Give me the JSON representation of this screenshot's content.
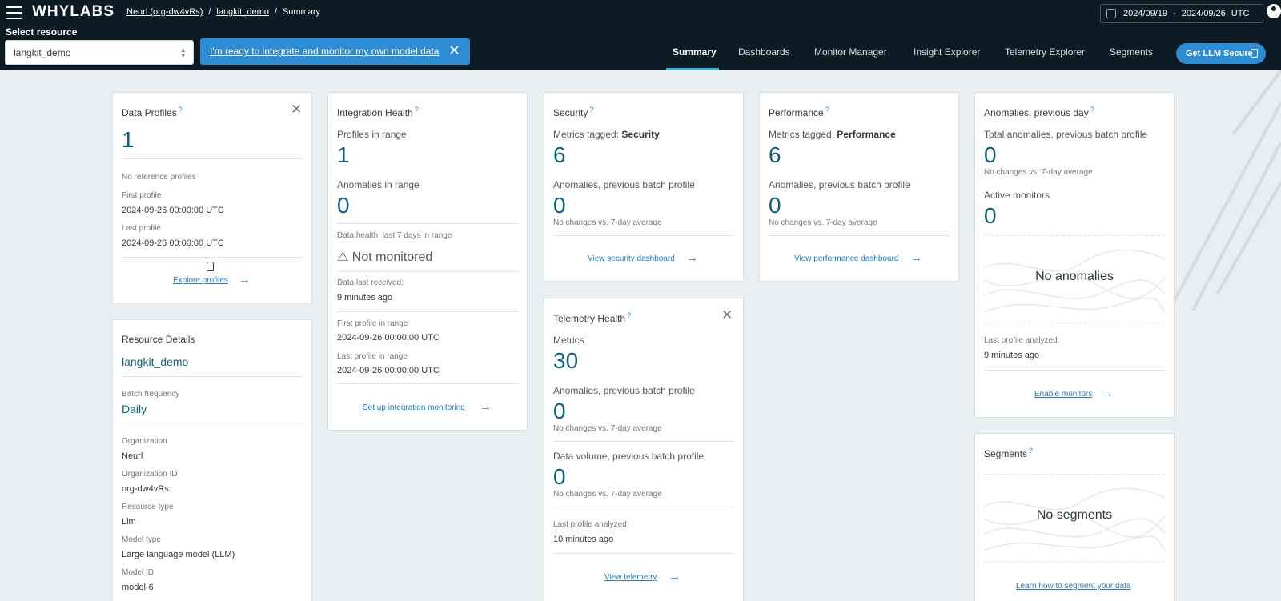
{
  "header": {
    "logo": "WHYLABS",
    "breadcrumb": [
      "Neurl (org-dw4vRs)",
      "langkit_demo",
      "Summary"
    ],
    "separator": "/",
    "date_start": "2024/09/19",
    "date_sep": "-",
    "date_end": "2024/09/26",
    "timezone": "UTC",
    "select_label": "Select resource",
    "selected_resource": "langkit_demo",
    "integrate_banner": "I'm ready to integrate and monitor my own model data",
    "nav": [
      "Summary",
      "Dashboards",
      "Monitor Manager",
      "Insight Explorer",
      "Telemetry Explorer",
      "Segments"
    ],
    "active_nav": "Summary",
    "llm_button": "Get LLM Secure"
  },
  "data_profiles": {
    "title": "Data Profiles",
    "count": "1",
    "no_reference": "No reference profiles",
    "first_label": "First profile",
    "first_value": "2024-09-26 00:00:00 UTC",
    "last_label": "Last profile",
    "last_value": "2024-09-26 00:00:00 UTC",
    "link": "Explore profiles"
  },
  "resource_details": {
    "title": "Resource Details",
    "name": "langkit_demo",
    "batch_label": "Batch frequency",
    "batch_value": "Daily",
    "org_label": "Organization",
    "org_value": "Neurl",
    "org_id_label": "Organization ID",
    "org_id_value": "org-dw4vRs",
    "type_label": "Resource type",
    "type_value": "Llm",
    "model_type_label": "Model type",
    "model_type_value": "Large language model (LLM)",
    "model_id_label": "Model ID",
    "model_id_value": "model-6"
  },
  "integration_health": {
    "title": "Integration Health",
    "profiles_label": "Profiles in range",
    "profiles_value": "1",
    "anomalies_label": "Anomalies in range",
    "anomalies_value": "0",
    "health_label": "Data health, last 7 days in range",
    "health_value": "Not monitored",
    "last_received_label": "Data last received:",
    "last_received_value": "9 minutes ago",
    "first_label": "First profile in range",
    "first_value": "2024-09-26 00:00:00 UTC",
    "last_label": "Last profile in range",
    "last_value": "2024-09-26 00:00:00 UTC",
    "link": "Set up integration monitoring"
  },
  "security": {
    "title": "Security",
    "tagged_prefix": "Metrics tagged:",
    "tagged_value": "Security",
    "metrics_value": "6",
    "anomalies_label": "Anomalies, previous batch profile",
    "anomalies_value": "0",
    "change_note": "No changes vs. 7-day average",
    "link": "View security dashboard"
  },
  "performance": {
    "title": "Performance",
    "tagged_prefix": "Metrics tagged:",
    "tagged_value": "Performance",
    "metrics_value": "6",
    "anomalies_label": "Anomalies, previous batch profile",
    "anomalies_value": "0",
    "change_note": "No changes vs. 7-day average",
    "link": "View performance dashboard"
  },
  "telemetry_health": {
    "title": "Telemetry Health",
    "metrics_label": "Metrics",
    "metrics_value": "30",
    "anomalies_label": "Anomalies, previous batch profile",
    "anomalies_value": "0",
    "anomalies_note": "No changes vs. 7-day average",
    "volume_label": "Data volume, previous batch profile",
    "volume_value": "0",
    "volume_note": "No changes vs. 7-day average",
    "last_label": "Last profile analyzed:",
    "last_value": "10 minutes ago",
    "link": "View telemetry"
  },
  "anomalies": {
    "title": "Anomalies, previous day",
    "total_label": "Total anomalies, previous batch profile",
    "total_value": "0",
    "total_note": "No changes vs. 7-day average",
    "active_label": "Active monitors",
    "active_value": "0",
    "empty_text": "No anomalies",
    "last_label": "Last profile analyzed:",
    "last_value": "9 minutes ago",
    "link": "Enable monitors"
  },
  "segments": {
    "title": "Segments",
    "empty_text": "No segments",
    "link": "Learn how to segment your data"
  },
  "icons": {
    "help": "?",
    "close": "✕",
    "arrow": "→",
    "warning": "⚠",
    "chevron": "⌃⌄"
  },
  "colors": {
    "header_bg": "#0d1c24",
    "accent": "#2c8cd4",
    "big_number": "#0e5f7a",
    "page_bg": "#e9eef0"
  }
}
